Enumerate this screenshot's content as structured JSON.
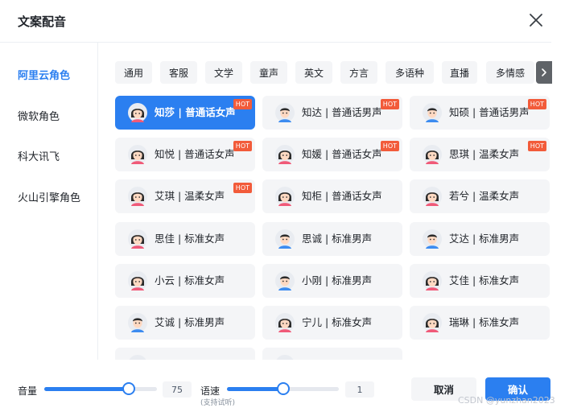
{
  "dialog": {
    "title": "文案配音"
  },
  "sidebar": {
    "items": [
      {
        "label": "阿里云角色",
        "active": true
      },
      {
        "label": "微软角色",
        "active": false
      },
      {
        "label": "科大讯飞",
        "active": false
      },
      {
        "label": "火山引擎角色",
        "active": false
      }
    ]
  },
  "tabs": [
    "通用",
    "客服",
    "文学",
    "童声",
    "英文",
    "方言",
    "多语种",
    "直播",
    "多情感"
  ],
  "voices": [
    {
      "label": "知莎 | 普通话女声",
      "gender": "female",
      "hot": true,
      "selected": true
    },
    {
      "label": "知达 | 普通话男声",
      "gender": "male",
      "hot": true,
      "selected": false
    },
    {
      "label": "知硕 | 普通话男声",
      "gender": "male",
      "hot": true,
      "selected": false
    },
    {
      "label": "知悦 | 普通话女声",
      "gender": "female",
      "hot": true,
      "selected": false
    },
    {
      "label": "知媛 | 普通话女声",
      "gender": "female",
      "hot": true,
      "selected": false
    },
    {
      "label": "思琪 | 温柔女声",
      "gender": "female",
      "hot": true,
      "selected": false
    },
    {
      "label": "艾琪 | 温柔女声",
      "gender": "female",
      "hot": true,
      "selected": false
    },
    {
      "label": "知柜 | 普通话女声",
      "gender": "female",
      "hot": false,
      "selected": false
    },
    {
      "label": "若兮 | 温柔女声",
      "gender": "female",
      "hot": false,
      "selected": false
    },
    {
      "label": "思佳 | 标准女声",
      "gender": "female",
      "hot": false,
      "selected": false
    },
    {
      "label": "思诚 | 标准男声",
      "gender": "male",
      "hot": false,
      "selected": false
    },
    {
      "label": "艾达 | 标准男声",
      "gender": "male",
      "hot": false,
      "selected": false
    },
    {
      "label": "小云 | 标准女声",
      "gender": "female",
      "hot": false,
      "selected": false
    },
    {
      "label": "小刚 | 标准男声",
      "gender": "male",
      "hot": false,
      "selected": false
    },
    {
      "label": "艾佳 | 标准女声",
      "gender": "female",
      "hot": false,
      "selected": false
    },
    {
      "label": "艾诚 | 标准男声",
      "gender": "male",
      "hot": false,
      "selected": false
    },
    {
      "label": "宁儿 | 标准女声",
      "gender": "female",
      "hot": false,
      "selected": false
    },
    {
      "label": "瑞琳 | 标准女声",
      "gender": "female",
      "hot": false,
      "selected": false
    },
    {
      "label": "",
      "gender": "female",
      "hot": false,
      "selected": false
    },
    {
      "label": "",
      "gender": "female",
      "hot": false,
      "selected": false
    }
  ],
  "hot_badge": "HOT",
  "footer": {
    "volume_label": "音量",
    "volume_value": "75",
    "volume_fraction": 0.75,
    "speed_label": "语速",
    "speed_hint": "(支持试听)",
    "speed_value": "1",
    "speed_fraction": 0.5,
    "cancel_label": "取消",
    "confirm_label": "确认"
  },
  "watermark": "CSDN @yunzhan2023",
  "colors": {
    "accent": "#2b7ff0",
    "hot": "#f25b3a",
    "card_bg": "#f4f5f7"
  }
}
